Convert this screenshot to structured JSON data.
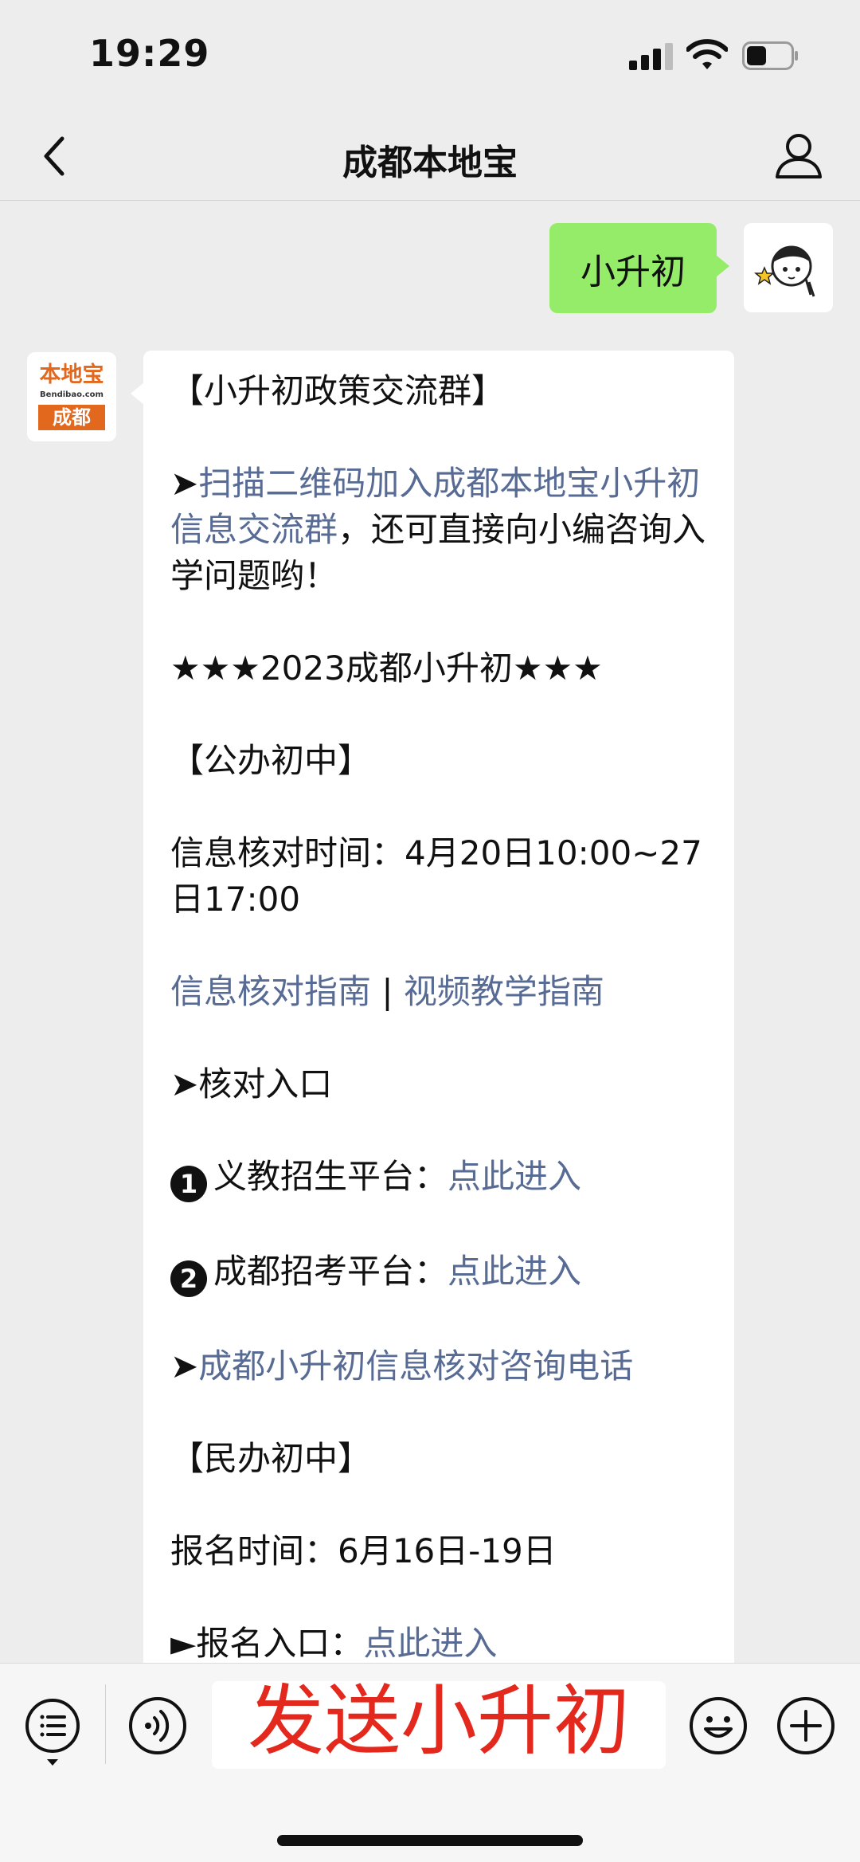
{
  "status_bar": {
    "time": "19:29",
    "icons": [
      "signal-icon",
      "wifi-icon",
      "battery-icon"
    ]
  },
  "nav": {
    "title": "成都本地宝",
    "icons": [
      "back-arrow-icon",
      "profile-icon"
    ]
  },
  "outgoing_message": {
    "text": "小升初"
  },
  "bot_avatar": {
    "logo_text": "本地宝",
    "logo_sub": "Bendibao.com",
    "logo_city": "成都",
    "brand_color": "#e2681d"
  },
  "message": {
    "title": "【小升初政策交流群】",
    "intro_arrow": "➤",
    "intro_link": "扫描二维码加入成都本地宝小升初信息交流群",
    "intro_text": "，还可直接向小编咨询入学问题哟！",
    "headline": "★★★2023成都小升初★★★",
    "public_heading": "【公办初中】",
    "verify_time": "信息核对时间：4月20日10:00~27日17:00",
    "guide_link_1": "信息核对指南",
    "guide_sep": " | ",
    "guide_link_2": "视频教学指南",
    "entry_heading": "➤核对入口",
    "entry1_num": "1",
    "entry1_label": "义教招生平台：",
    "entry1_link": "点此进入",
    "entry2_num": "2",
    "entry2_label": "成都招考平台：",
    "entry2_link": "点此进入",
    "hotline_arrow": "➤",
    "hotline_link": "成都小升初信息核对咨询电话",
    "private_heading": "【民办初中】",
    "register_time": "报名时间：6月16日-19日",
    "register_label": "►报名入口：",
    "register_link": "点此进入"
  },
  "bottom_bar": {
    "overlay_text": "发送小升初",
    "overlay_color": "#e3281d",
    "icons": [
      "menu-list-icon",
      "voice-icon",
      "emoji-icon",
      "plus-icon"
    ]
  },
  "colors": {
    "link": "#576b95",
    "outgoing_bubble": "#95ec69",
    "background": "#ededed"
  }
}
